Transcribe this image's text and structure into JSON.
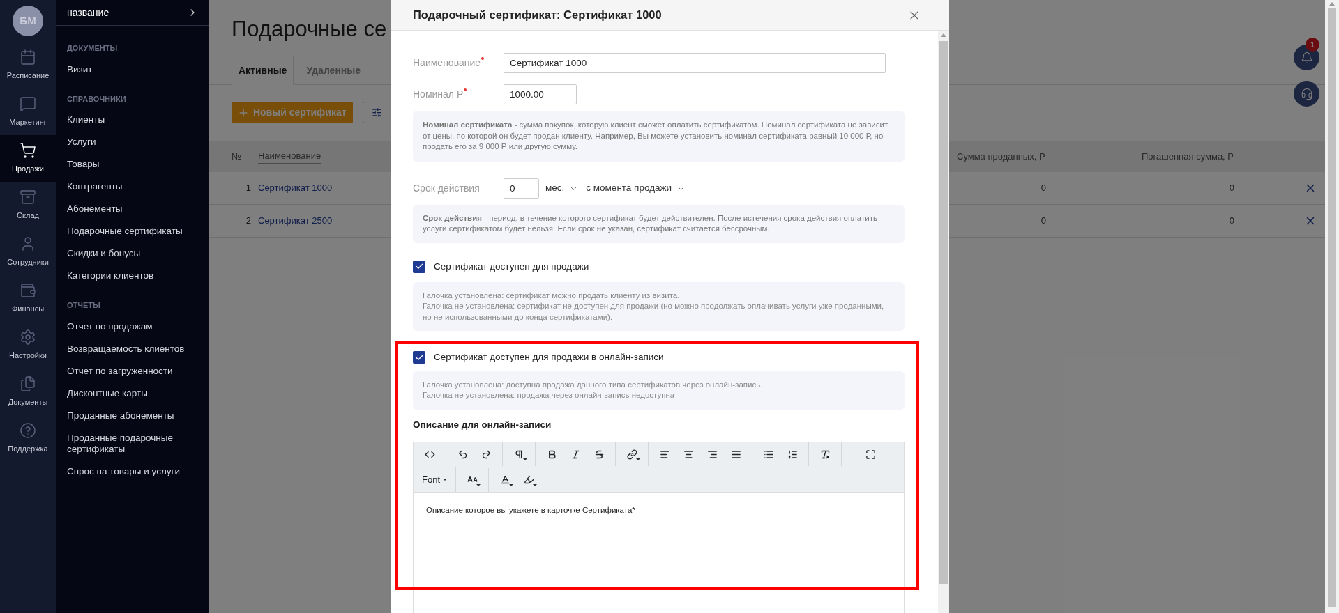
{
  "nav_rail": {
    "avatar": "БМ",
    "items": [
      {
        "label": "Расписание",
        "selected": false
      },
      {
        "label": "Маркетинг",
        "selected": false
      },
      {
        "label": "Продажи",
        "selected": true
      },
      {
        "label": "Склад",
        "selected": false
      },
      {
        "label": "Сотрудники",
        "selected": false
      },
      {
        "label": "Финансы",
        "selected": false
      },
      {
        "label": "Настройки",
        "selected": false
      },
      {
        "label": "Документы",
        "selected": false
      },
      {
        "label": "Поддержка",
        "selected": false
      }
    ]
  },
  "sidebar": {
    "header": "название",
    "sections": [
      {
        "title": "ДОКУМЕНТЫ",
        "items": [
          "Визит"
        ]
      },
      {
        "title": "СПРАВОЧНИКИ",
        "items": [
          "Клиенты",
          "Услуги",
          "Товары",
          "Контрагенты",
          "Абонементы",
          "Подарочные сертификаты",
          "Скидки и бонусы",
          "Категории клиентов"
        ]
      },
      {
        "title": "ОТЧЕТЫ",
        "items": [
          "Отчет по продажам",
          "Возвращаемость клиентов",
          "Отчет по загруженности",
          "Дисконтные карты",
          "Проданные абонементы",
          "Проданные подарочные сертификаты",
          "Спрос на товары и услуги"
        ]
      }
    ]
  },
  "page": {
    "title": "Подарочные се",
    "tabs": [
      {
        "label": "Активные",
        "selected": true
      },
      {
        "label": "Удаленные",
        "selected": false
      }
    ],
    "new_button": "Новый сертификат",
    "table": {
      "columns": [
        "№",
        "Наименование",
        "Сумма проданных, Р",
        "Погашенная сумма, Р"
      ],
      "rows": [
        {
          "number": "1",
          "name": "Сертификат 1000",
          "sold_sum": "0",
          "redeemed_sum": "0"
        },
        {
          "number": "2",
          "name": "Сертификат 2500",
          "sold_sum": "0",
          "redeemed_sum": "0"
        }
      ]
    }
  },
  "notifications": {
    "badge": "1"
  },
  "modal": {
    "title": "Подарочный сертификат: Сертификат 1000",
    "fields": [
      {
        "label": "Наименование",
        "required": true,
        "value": "Сертификат 1000",
        "kind": "wide"
      },
      {
        "label": "Номинал Р",
        "required": true,
        "value": "1000.00",
        "kind": "narrow"
      }
    ],
    "nominal_note": "**Номинал сертификата** - сумма покупок, которую клиент сможет оплатить сертификатом. Номинал сертификата не зависит от цены, по которой он будет продан клиенту. Например, Вы можете установить номинал сертификата равный 10 000 Р, но продать его за 9 000 Р или другую сумму.",
    "validity": {
      "label": "Срок действия",
      "value": "0",
      "unit": "мес.",
      "start": "с момента продажи"
    },
    "validity_note": "**Срок действия** - период, в течение которого сертификат будет действителен. После истечения срока действия оплатить услуги сертификатом будет нельзя. Если срок не указан, сертификат считается бессрочным.",
    "options": [
      {
        "label": "Сертификат доступен для продажи",
        "checked": true,
        "note_lines": [
          "Галочка установлена: сертификат можно продать клиенту из визита.",
          "Галочка не установлена: сертификат не доступен для продажи (но можно продолжать оплачивать услуги уже проданными, но не использованными до конца сертификатами)."
        ]
      },
      {
        "label": "Сертификат доступен для продажи в онлайн-записи",
        "checked": true,
        "note_lines": [
          "Галочка установлена: доступна продажа данного типа сертификатов через онлайн-запись.",
          "Галочка не установлена: продажа через онлайн-запись недоступна"
        ]
      }
    ],
    "description_label": "Описание для онлайн-записи",
    "editor": {
      "font_button": "Font",
      "content": "Описание которое вы укажете в карточке Сертификата*"
    }
  }
}
